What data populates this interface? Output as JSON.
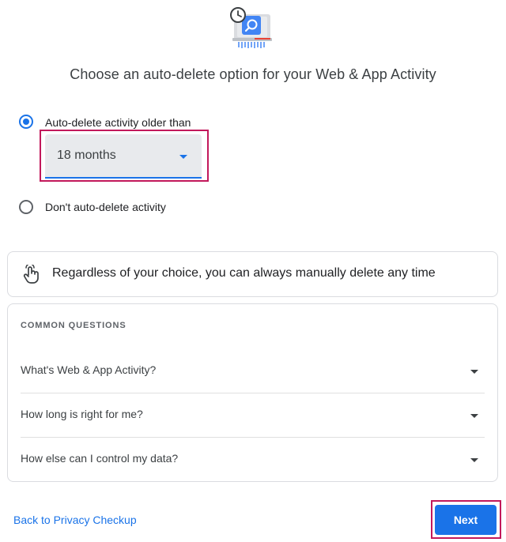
{
  "header": {
    "illustration_icon": "history-search-shredder-icon",
    "title": "Choose an auto-delete option for your Web & App Activity"
  },
  "options": {
    "auto_delete": {
      "label": "Auto-delete activity older than",
      "selected": true
    },
    "duration_select": {
      "value": "18 months",
      "icon": "chevron-down-icon"
    },
    "dont_auto_delete": {
      "label": "Don't auto-delete activity",
      "selected": false
    }
  },
  "info": {
    "icon": "touch-hand-icon",
    "text": "Regardless of your choice, you can always manually delete any time"
  },
  "faq": {
    "heading": "COMMON QUESTIONS",
    "items": [
      {
        "question": "What's Web & App Activity?"
      },
      {
        "question": "How long is right for me?"
      },
      {
        "question": "How else can I control my data?"
      }
    ]
  },
  "footer": {
    "back_label": "Back to Privacy Checkup",
    "next_label": "Next"
  },
  "colors": {
    "accent": "#1a73e8",
    "highlight": "#c2185b"
  }
}
